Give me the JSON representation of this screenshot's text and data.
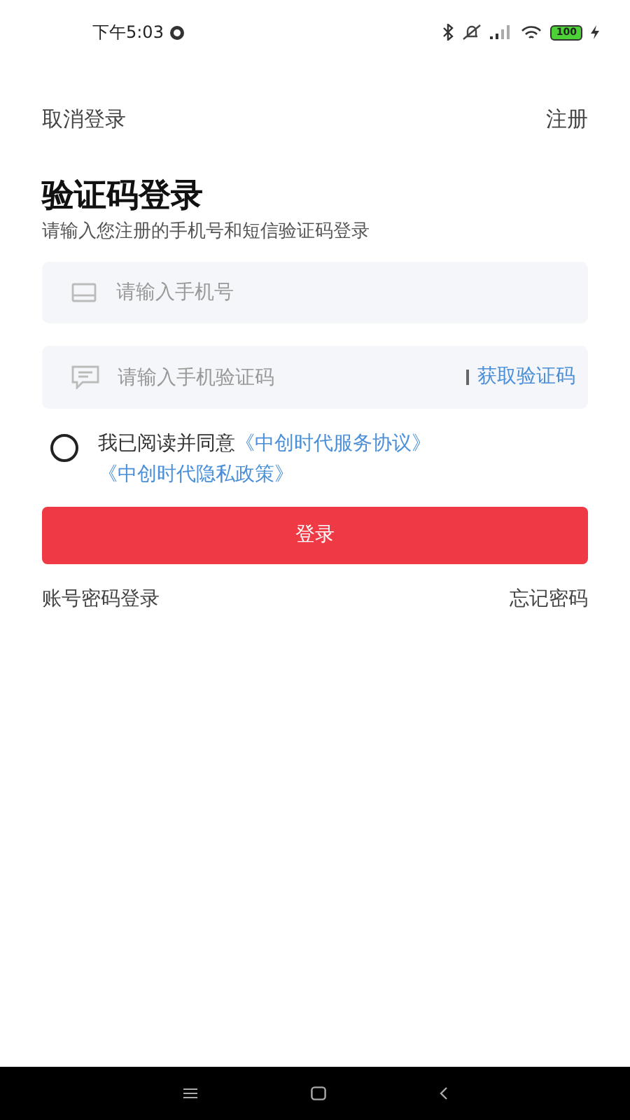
{
  "status_bar": {
    "time": "下午5:03",
    "battery": "100"
  },
  "nav": {
    "cancel": "取消登录",
    "register": "注册"
  },
  "title": "验证码登录",
  "subtitle": "请输入您注册的手机号和短信验证码登录",
  "phone_field": {
    "placeholder": "请输入手机号"
  },
  "code_field": {
    "placeholder": "请输入手机验证码",
    "get_code": "获取验证码"
  },
  "agreement": {
    "checked": false,
    "text": "我已阅读并同意",
    "links": [
      "《中创时代服务协议》",
      "《中创时代隐私政策》"
    ]
  },
  "login_button": "登录",
  "footer_links": [
    "账号密码登录",
    "忘记密码"
  ]
}
